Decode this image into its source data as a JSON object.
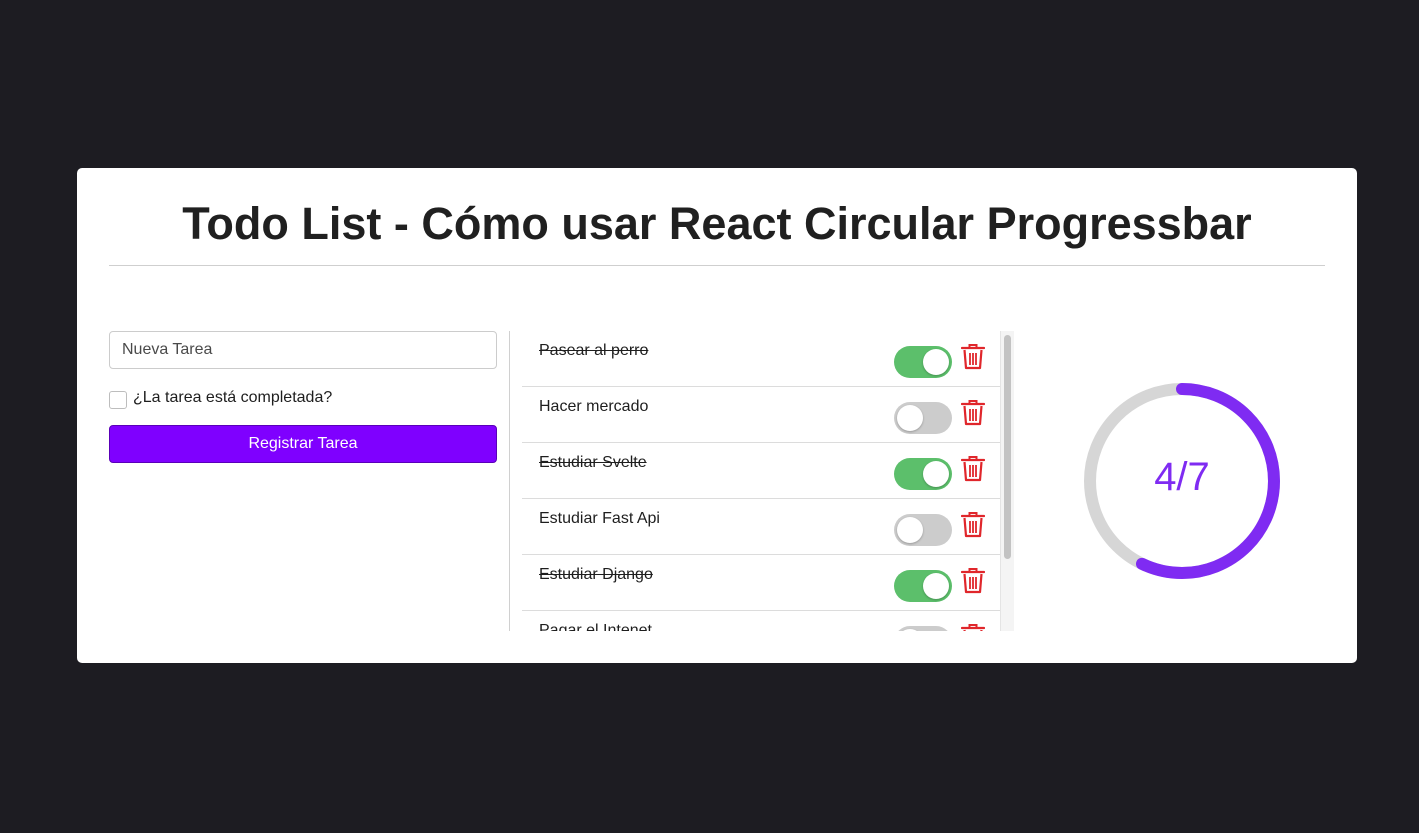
{
  "header": {
    "title": "Todo List - Cómo usar React Circular Progressbar"
  },
  "form": {
    "input_placeholder": "Nueva Tarea",
    "input_value": "",
    "checkbox_label": "¿La tarea está completada?",
    "checkbox_checked": false,
    "submit_label": "Registrar Tarea"
  },
  "tasks": [
    {
      "name": "Pasear al perro",
      "completed": true
    },
    {
      "name": "Hacer mercado",
      "completed": false
    },
    {
      "name": "Estudiar Svelte",
      "completed": true
    },
    {
      "name": "Estudiar Fast Api",
      "completed": false
    },
    {
      "name": "Estudiar Django",
      "completed": true
    },
    {
      "name": "Pagar el Intenet",
      "completed": false
    }
  ],
  "icons": {
    "toggle": "toggle-switch-icon",
    "delete": "trash-icon"
  },
  "progress": {
    "completed": 4,
    "total": 7,
    "label": "4/7"
  },
  "colors": {
    "background": "#1d1c22",
    "accent": "#7f00ff",
    "progress_path": "#7f2bf2",
    "progress_trail": "#d6d6d6",
    "toggle_on": "#5cbf6b",
    "toggle_off": "#cccccc",
    "delete": "#e0262b"
  }
}
